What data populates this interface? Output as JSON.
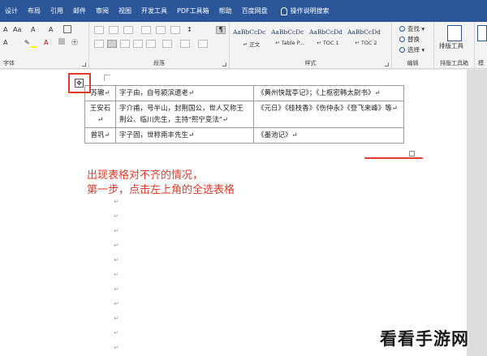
{
  "ribbon_tabs": [
    "设计",
    "布局",
    "引用",
    "邮件",
    "审阅",
    "视图",
    "开发工具",
    "PDF工具箱",
    "帮助",
    "百度网盘"
  ],
  "search_label": "操作说明搜索",
  "font_group": {
    "label": "字体",
    "row1": [
      "A",
      "Aa",
      "A",
      "A"
    ],
    "row2_marker": "✎",
    "row2_font_color": "A",
    "highlight_color": "#ffff00",
    "font_color": "#c00000"
  },
  "paragraph_group": {
    "label": "段落",
    "sort_icon": "↕",
    "show_marks_icon": "¶"
  },
  "styles_group": {
    "label": "样式",
    "styles": [
      {
        "sample": "AaBbCcDc",
        "name": "↵ 正文"
      },
      {
        "sample": "AaBbCcDc",
        "name": "↵ Table P..."
      },
      {
        "sample": "AaBbCcDd",
        "name": "↵ TOC 1"
      },
      {
        "sample": "AaBbCcDd",
        "name": "↵ TOC 2"
      }
    ]
  },
  "editing_group": {
    "label": "编辑",
    "items": [
      "查找 ▾",
      "替换",
      "选择 ▾"
    ]
  },
  "layout_tool": {
    "button": "排版工具",
    "label": "排版工具箱"
  },
  "extra_group": {
    "button": "",
    "label": "模"
  },
  "table": {
    "rows": [
      [
        "苏辙↵",
        "字子由，自号颍滨遗老↵",
        "《黄州快哉亭记》；《上枢密韩太尉书》↵"
      ],
      [
        "王安石↵",
        "字介甫，号半山，封荆国公，世人又称王荆公、临川先生，主持\"熙宁变法\"↵",
        "《元日》《桂枝香》《伤仲永》《登飞来峰》等↵"
      ],
      [
        "曾巩↵",
        "字子固，世称南丰先生↵",
        "《墨池记》↵"
      ]
    ]
  },
  "move_handle_icon": "✥",
  "paragraph_mark": "↵",
  "annotation": {
    "line1": "出现表格对不齐的情况，",
    "line2": "第一步，点击左上角的全选表格"
  },
  "watermark": "看看手游网",
  "colors": {
    "ribbon_blue": "#2b579a",
    "annotation_red": "#e23a2b"
  }
}
